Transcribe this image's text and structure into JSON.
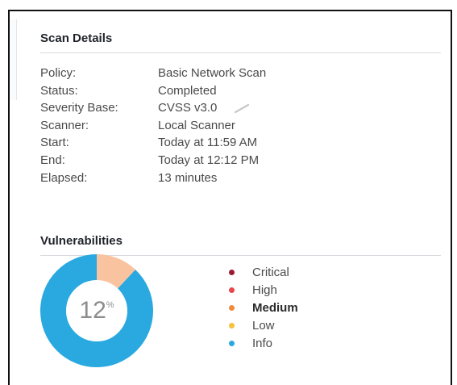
{
  "scan_details": {
    "title": "Scan Details",
    "rows": [
      {
        "label": "Policy:",
        "value": "Basic Network Scan"
      },
      {
        "label": "Status:",
        "value": "Completed"
      },
      {
        "label": "Severity Base:",
        "value": "CVSS v3.0"
      },
      {
        "label": "Scanner:",
        "value": "Local Scanner"
      },
      {
        "label": "Start:",
        "value": "Today at 11:59 AM"
      },
      {
        "label": "End:",
        "value": "Today at 12:12 PM"
      },
      {
        "label": "Elapsed:",
        "value": "13 minutes"
      }
    ]
  },
  "vulnerabilities": {
    "title": "Vulnerabilities",
    "percent_value": "12",
    "percent_unit": "%",
    "medium_fraction": 0.12,
    "info_fraction": 0.88,
    "legend": [
      {
        "label": "Critical",
        "color": "#9b1b30"
      },
      {
        "label": "High",
        "color": "#e8464c"
      },
      {
        "label": "Medium",
        "color": "#f08a3c",
        "emphasized": true
      },
      {
        "label": "Low",
        "color": "#f6c23a"
      },
      {
        "label": "Info",
        "color": "#29a9e0"
      }
    ],
    "chart_colors": {
      "medium": "#fac3a0",
      "info": "#29a9e0"
    }
  }
}
